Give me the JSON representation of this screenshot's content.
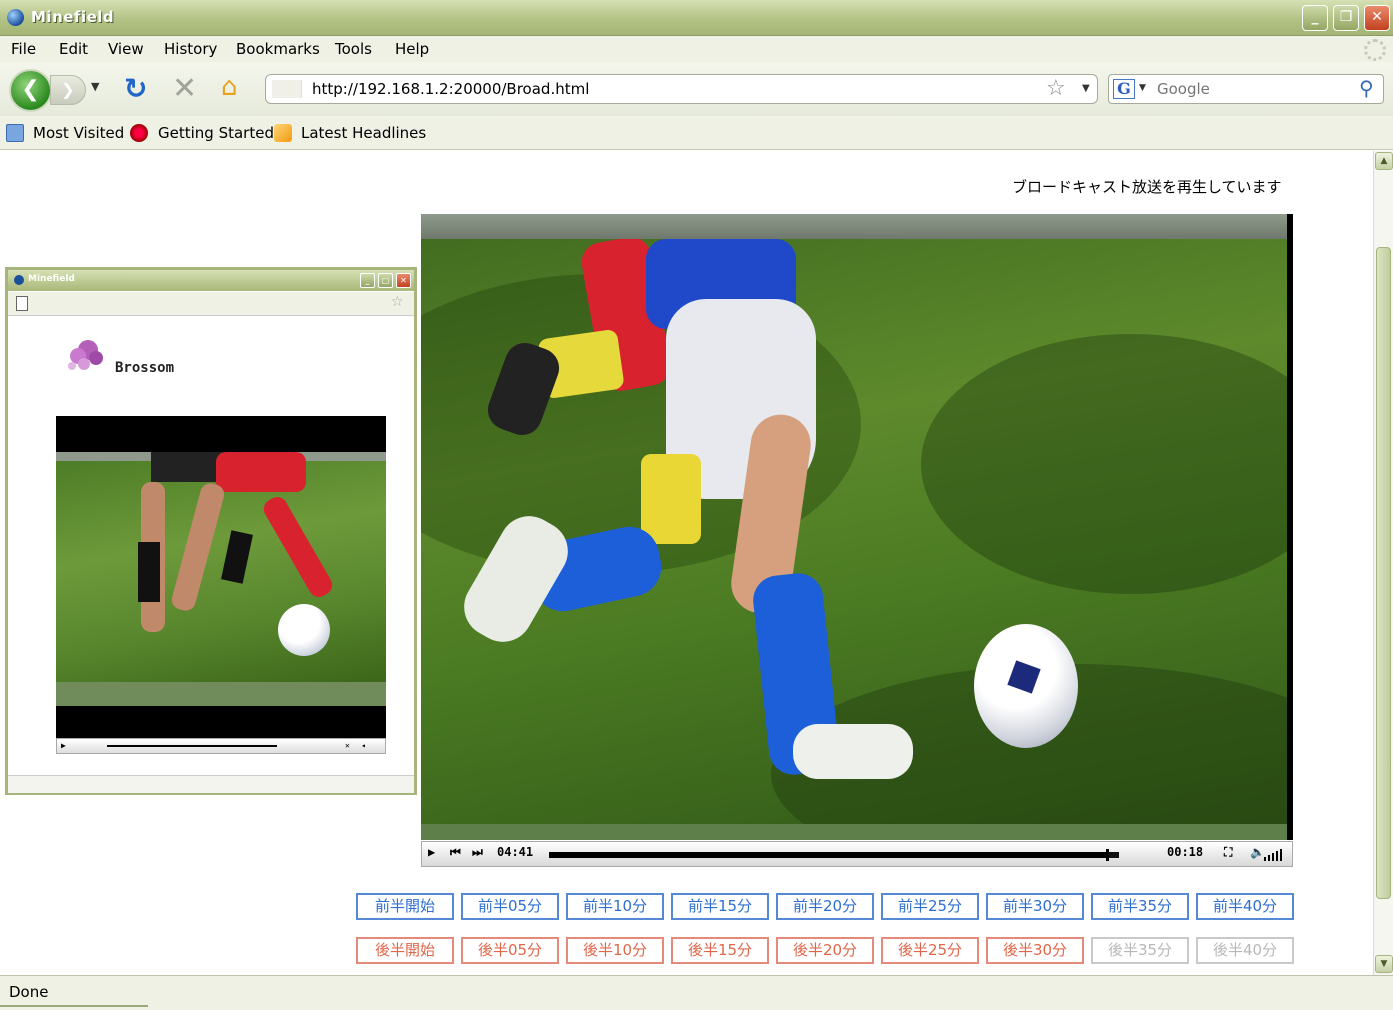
{
  "window": {
    "title": "Minefield"
  },
  "menu": [
    "File",
    "Edit",
    "View",
    "History",
    "Bookmarks",
    "Tools",
    "Help"
  ],
  "nav": {
    "url": "http://192.168.1.2:20000/Broad.html",
    "search_placeholder": "Google"
  },
  "bookmarks": [
    "Most Visited",
    "Getting Started",
    "Latest Headlines"
  ],
  "page": {
    "broadcast_message": "ブロードキャスト放送を再生しています",
    "player": {
      "elapsed": "04:41",
      "remaining": "00:18",
      "progress": 0.98
    },
    "jump_first_half": [
      "前半開始",
      "前半05分",
      "前半10分",
      "前半15分",
      "前半20分",
      "前半25分",
      "前半30分",
      "前半35分",
      "前半40分"
    ],
    "jump_second_half": [
      "後半開始",
      "後半05分",
      "後半10分",
      "後半15分",
      "後半20分",
      "後半25分",
      "後半30分",
      "後半35分",
      "後半40分"
    ],
    "second_half_enabled_count": 7
  },
  "mini_window": {
    "title": "Minefield",
    "logo_text": "Brossom"
  },
  "status": {
    "text": "Done"
  },
  "colors": {
    "first_half": "#2e6fd0",
    "second_half": "#e0664a",
    "disabled": "#b8b8b8",
    "chrome": "#b3c386"
  },
  "icons": {
    "back": "arrow-left-icon",
    "forward": "arrow-right-icon",
    "reload": "reload-icon",
    "stop": "stop-icon",
    "home": "home-icon",
    "bookmark_star": "star-icon",
    "search_go": "magnifier-icon"
  }
}
